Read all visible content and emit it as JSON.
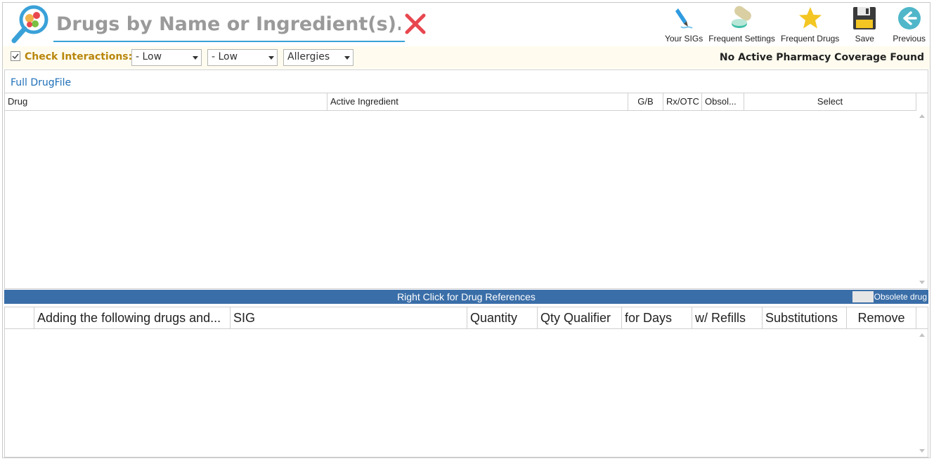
{
  "search": {
    "placeholder": "Drugs by Name or Ingredient(s)..."
  },
  "toolbar": {
    "items": [
      {
        "label": "Your SIGs",
        "icon": "pen-sig-icon"
      },
      {
        "label": "Frequent Settings",
        "icon": "pills-icon"
      },
      {
        "label": "Frequent Drugs",
        "icon": "star-icon"
      },
      {
        "label": "Save",
        "icon": "floppy-disk-icon"
      },
      {
        "label": "Previous",
        "icon": "back-arrow-icon"
      }
    ]
  },
  "interactions": {
    "label": "Check Interactions:",
    "checked": true,
    "severity1": "- Low",
    "severity2": "- Low",
    "allergies": "Allergies",
    "coverage": "No Active Pharmacy Coverage Found"
  },
  "drug_grid": {
    "link": "Full DrugFile",
    "columns": [
      "Drug",
      "Active Ingredient",
      "G/B",
      "Rx/OTC",
      "Obsol...",
      "Select"
    ]
  },
  "status_bar": {
    "text": "Right Click for Drug References",
    "legend": "Obsolete drug"
  },
  "order_grid": {
    "columns": [
      "",
      "Adding the following drugs and...",
      "SIG",
      "Quantity",
      "Qty Qualifier",
      "for Days",
      "w/ Refills",
      "Substitutions",
      "Remove"
    ]
  },
  "colors": {
    "accent": "#3aa1d8",
    "interaction_label": "#b8860b",
    "status_bar": "#3a6ea8",
    "clear": "#e8474f",
    "link": "#1e6fb8"
  }
}
